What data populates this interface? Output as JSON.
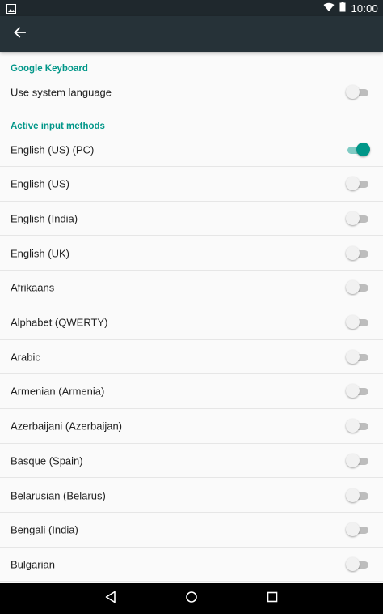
{
  "status_bar": {
    "time": "10:00",
    "left_icon": "image-notification-icon",
    "wifi_icon": "wifi-icon",
    "battery_icon": "battery-icon"
  },
  "app_bar": {
    "back_icon": "arrow-back-icon",
    "background_color": "#263238"
  },
  "accent_color": "#009688",
  "google_keyboard": {
    "header": "Google Keyboard",
    "use_system_language": {
      "label": "Use system language",
      "enabled": false
    }
  },
  "active_input_methods": {
    "header": "Active input methods",
    "items": [
      {
        "label": "English (US) (PC)",
        "enabled": true
      },
      {
        "label": "English (US)",
        "enabled": false
      },
      {
        "label": "English (India)",
        "enabled": false
      },
      {
        "label": "English (UK)",
        "enabled": false
      },
      {
        "label": "Afrikaans",
        "enabled": false
      },
      {
        "label": "Alphabet (QWERTY)",
        "enabled": false
      },
      {
        "label": "Arabic",
        "enabled": false
      },
      {
        "label": "Armenian (Armenia)",
        "enabled": false
      },
      {
        "label": "Azerbaijani (Azerbaijan)",
        "enabled": false
      },
      {
        "label": "Basque (Spain)",
        "enabled": false
      },
      {
        "label": "Belarusian (Belarus)",
        "enabled": false
      },
      {
        "label": "Bengali (India)",
        "enabled": false
      },
      {
        "label": "Bulgarian",
        "enabled": false
      }
    ]
  },
  "nav_bar": {
    "back_icon": "nav-back-triangle-icon",
    "home_icon": "nav-home-circle-icon",
    "recents_icon": "nav-recents-square-icon"
  }
}
